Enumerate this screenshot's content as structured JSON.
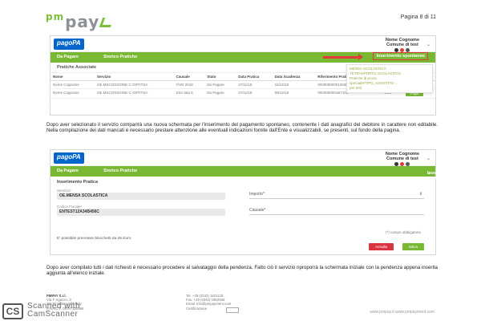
{
  "header": {
    "logo_prefix": "pm",
    "logo_text": "pay",
    "page_label": "Pagina 8 di 11"
  },
  "app": {
    "brand": "pagoPA",
    "user_name": "Nome Cognome",
    "user_entity": "Comune di test",
    "nav": {
      "da_pagare": "Da Pagare",
      "storico": "Storico Pratiche",
      "spontaneo": "Inserimento spontaneo",
      "spontaneo_chevron": "⌄"
    }
  },
  "shot1": {
    "section_title": "Pratiche Associate",
    "columns": [
      "Nome",
      "Servizio",
      "Causale",
      "Stato",
      "Data Pratica",
      "Data Scadenza",
      "Riferimento Pratica / IUV",
      "Impor"
    ],
    "rows": [
      [
        "Nome Cognome",
        "OE.MSCOSSIONE C GRTITSA",
        "TARI 2018",
        "Da Pagare",
        "27/11/18",
        "16/12/18",
        "000000000012600",
        "1.00"
      ],
      [
        "Nome Cognome",
        "OE.MSCOSSIONE C GRTITSA",
        "SSA tata 6",
        "Da Pagare",
        "27/11/18",
        "08/12/18",
        "0000000001B7106",
        "1.00"
      ]
    ],
    "pay_label": "Paga",
    "dropdown_items": [
      "MENSA SCOLASTICA",
      "TETRASPORTO SCOLASTICO",
      "Pratiche di prova",
      "speciale#TIPO_ASSISTITO ...",
      "per test"
    ]
  },
  "paragraph1": "Dopo aver selezionato il servizio comparirà una nuova schermata per l'inserimento del pagamento spontaneo, contenente i dati anagrafici del debitore in carattere non editabile. Nella compilazione dei dati mancati è necessario prestare attenzione alle eventuali indicazioni fornite dall'Ente e visualizzabili, se presenti, sul fondo della pagina.",
  "shot2": {
    "form_title": "Inserimento Pratica",
    "servizio_label": "Servizio*",
    "servizio_value": "OE.MENSA SCOLASTICA",
    "cf_label": "Codice Fiscale*",
    "cf_value": "ENTEST12A34B456C",
    "importo_label": "Importo*",
    "causale_label": "Causale*",
    "required_note": "(*) campo obbligatorio",
    "pren_note": "E' possibile prenotare blocchetti da 25 Euro",
    "annulla_label": "Annulla",
    "salva_label": "Salva"
  },
  "paragraph2": "Dopo aver compilato tutti i dati richiesti è necessario procedere al salvataggio della pendenza. Fatto ciò il servizio riproporrà la schermata iniziale con la pendenza appena inserita aggiunta all'elenco iniziale.",
  "footer": {
    "company": "PMPAY S.r.l.",
    "addr1": "Via T. Agazzo, 3",
    "addr2": "20174 Milano (MI) Italy",
    "addr3": "P.IVA/C.F. 08787320966",
    "tel": "Tel. +39 (0342) 1821125",
    "fax": "Fax. +39 (0342) 1852559",
    "email": "Email. info@pmpayment.com",
    "cert": "Certificazione",
    "site": "www.pmpay.it  www.pmpayment.com"
  },
  "scanner": {
    "badge": "CS",
    "line1": "Scanned with",
    "line2": "CamScanner"
  },
  "colors": {
    "nav_green": "#78b833",
    "brand_blue": "#0066cc",
    "highlight_red": "#e23a3a"
  }
}
